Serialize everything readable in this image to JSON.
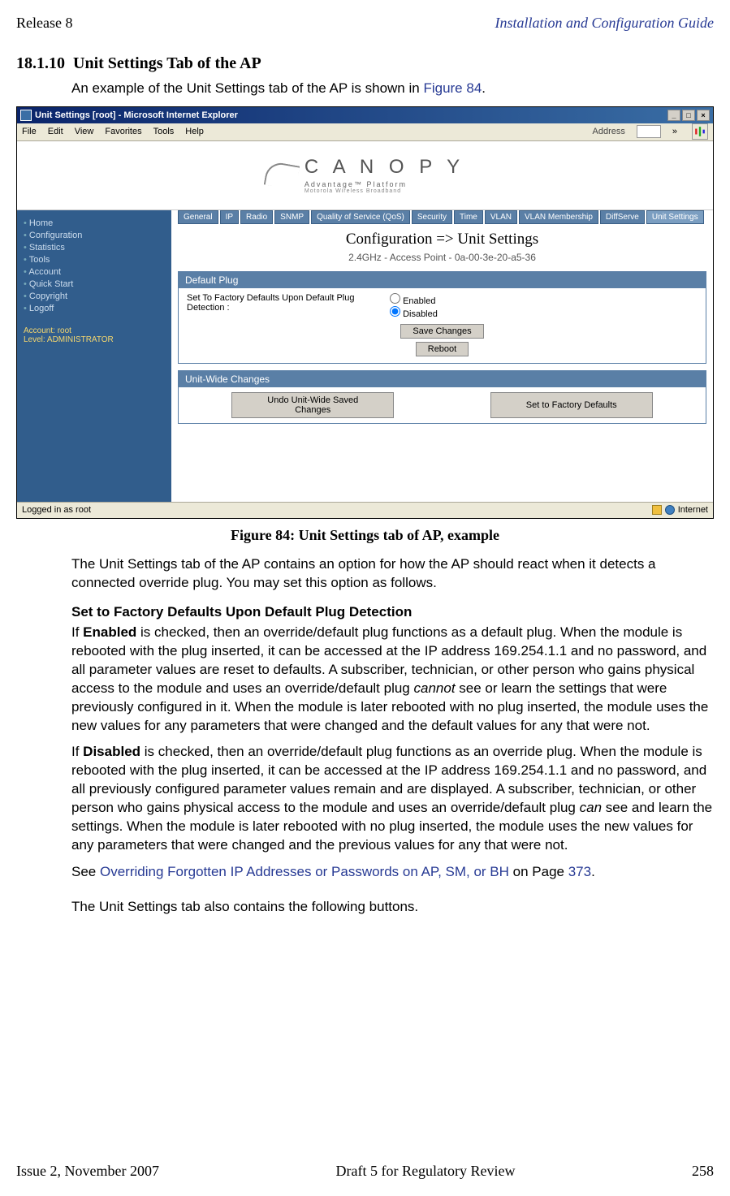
{
  "header": {
    "left": "Release 8",
    "right": "Installation and Configuration Guide"
  },
  "section": {
    "number": "18.1.10",
    "title": "Unit Settings Tab of the AP"
  },
  "intro": {
    "text": "An example of the Unit Settings tab of the AP is shown in ",
    "ref": "Figure 84",
    "suffix": "."
  },
  "browser": {
    "title": "Unit Settings [root] - Microsoft Internet Explorer",
    "menu": [
      "File",
      "Edit",
      "View",
      "Favorites",
      "Tools",
      "Help"
    ],
    "address_label": "Address",
    "status_left": "Logged in as root",
    "status_right": "Internet"
  },
  "canopy": {
    "brand": "C A N O P Y",
    "sub": "Advantage™ Platform",
    "sub2": "Motorola Wireless Broadband"
  },
  "sidebar": {
    "items": [
      "Home",
      "Configuration",
      "Statistics",
      "Tools",
      "Account",
      "Quick Start",
      "Copyright",
      "Logoff"
    ],
    "account_label": "Account: root",
    "level_label": "Level: ADMINISTRATOR"
  },
  "tabs": [
    "General",
    "IP",
    "Radio",
    "SNMP",
    "Quality of Service (QoS)",
    "Security",
    "Time",
    "VLAN",
    "VLAN Membership",
    "DiffServe",
    "Unit Settings"
  ],
  "config": {
    "title": "Configuration => Unit Settings",
    "subtitle": "2.4GHz - Access Point - 0a-00-3e-20-a5-36"
  },
  "panel1": {
    "header": "Default Plug",
    "setting_label": "Set To Factory Defaults Upon Default Plug Detection :",
    "opt_enabled": "Enabled",
    "opt_disabled": "Disabled",
    "save_btn": "Save Changes",
    "reboot_btn": "Reboot"
  },
  "panel2": {
    "header": "Unit-Wide Changes",
    "undo_btn": "Undo Unit-Wide Saved Changes",
    "factory_btn": "Set to Factory Defaults"
  },
  "caption": "Figure 84: Unit Settings tab of AP, example",
  "para1": "The Unit Settings tab of the AP contains an option for how the AP should react when it detects a connected override plug. You may set this option as follows.",
  "subheading": "Set to Factory Defaults Upon Default Plug Detection",
  "enabled": {
    "bold": "Enabled",
    "prefix": "If ",
    "text1": " is checked, then an override/default plug functions as a default plug. When the module is rebooted with the plug inserted, it can be accessed at the IP address 169.254.1.1 and no password, and all parameter values are reset to defaults. A subscriber, technician, or other person who gains physical access to the module and uses an override/default plug ",
    "italic": "cannot",
    "text2": " see or learn the settings that were previously configured in it. When the module is later rebooted with no plug inserted, the module uses the new values for any parameters that were changed and the default values for any that were not."
  },
  "disabled": {
    "bold": "Disabled",
    "prefix": "If ",
    "text1": " is checked, then an override/default plug functions as an override plug. When the module is rebooted with the plug inserted, it can be accessed at the IP address 169.254.1.1 and no password, and all previously configured parameter values remain and are displayed. A subscriber, technician, or other person who gains physical access to the module and uses an override/default plug ",
    "italic": "can",
    "text2": " see and learn the settings. When the module is later rebooted with no plug inserted, the module uses the new values for any parameters that were changed and the previous values for any that were not."
  },
  "see": {
    "prefix": "See ",
    "link": "Overriding Forgotten IP Addresses or Passwords on AP, SM, or BH",
    "mid": " on Page ",
    "page": "373",
    "suffix": "."
  },
  "para_last": "The Unit Settings tab also contains the following buttons.",
  "footer": {
    "left": "Issue 2, November 2007",
    "center": "Draft 5 for Regulatory Review",
    "right": "258"
  }
}
